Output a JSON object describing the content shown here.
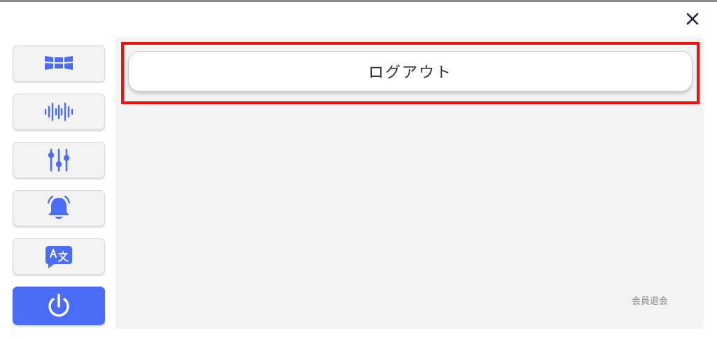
{
  "dialog": {
    "close_icon": "close-icon"
  },
  "sidebar": {
    "accent_color": "#4a6cf7",
    "items": [
      {
        "icon": "layout-grid-icon",
        "active": false
      },
      {
        "icon": "sound-wave-icon",
        "active": false
      },
      {
        "icon": "sliders-icon",
        "active": false
      },
      {
        "icon": "bell-ringing-icon",
        "active": false
      },
      {
        "icon": "translate-icon",
        "active": false
      },
      {
        "icon": "power-icon",
        "active": true
      }
    ]
  },
  "main": {
    "logout_label": "ログアウト",
    "withdraw_label": "会員退会",
    "highlight_color": "#ee1111"
  }
}
